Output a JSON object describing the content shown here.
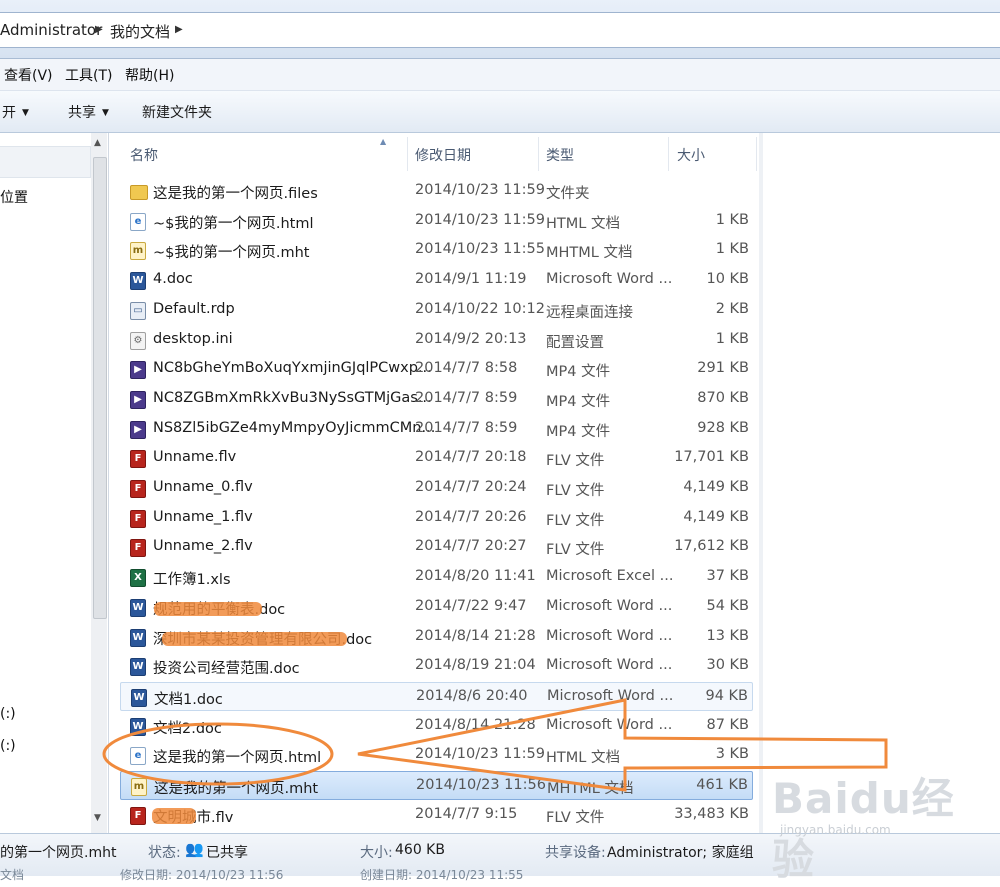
{
  "breadcrumb": {
    "items": [
      "Administrator",
      "我的文档"
    ]
  },
  "menu": {
    "items": [
      "查看(V)",
      "工具(T)",
      "帮助(H)"
    ]
  },
  "toolbar": {
    "open_label": "开",
    "share_label": "共享",
    "new_folder_label": "新建文件夹"
  },
  "nav": {
    "items": [
      "位置",
      "(:)",
      "(:)"
    ]
  },
  "columns": {
    "name": "名称",
    "date": "修改日期",
    "type": "类型",
    "size": "大小"
  },
  "files": [
    {
      "icon": "folder-icon",
      "name": "这是我的第一个网页.files",
      "date": "2014/10/23 11:59",
      "type": "文件夹",
      "size": ""
    },
    {
      "icon": "ie-html-icon",
      "name": "~$我的第一个网页.html",
      "date": "2014/10/23 11:59",
      "type": "HTML 文档",
      "size": "1 KB"
    },
    {
      "icon": "mht-icon",
      "name": "~$我的第一个网页.mht",
      "date": "2014/10/23 11:55",
      "type": "MHTML 文档",
      "size": "1 KB"
    },
    {
      "icon": "word-doc-icon",
      "name": "4.doc",
      "date": "2014/9/1 11:19",
      "type": "Microsoft Word ...",
      "size": "10 KB"
    },
    {
      "icon": "rdp-icon",
      "name": "Default.rdp",
      "date": "2014/10/22 10:12",
      "type": "远程桌面连接",
      "size": "2 KB"
    },
    {
      "icon": "ini-icon",
      "name": "desktop.ini",
      "date": "2014/9/2 20:13",
      "type": "配置设置",
      "size": "1 KB"
    },
    {
      "icon": "mp4-icon",
      "name": "NC8bGheYmBoXuqYxmjinGJqlPCwxp...",
      "date": "2014/7/7 8:58",
      "type": "MP4 文件",
      "size": "291 KB"
    },
    {
      "icon": "mp4-icon",
      "name": "NC8ZGBmXmRkXvBu3NySsGTMjGas...",
      "date": "2014/7/7 8:59",
      "type": "MP4 文件",
      "size": "870 KB"
    },
    {
      "icon": "mp4-icon",
      "name": "NS8Zl5ibGZe4myMmpyOyJicmmCMn...",
      "date": "2014/7/7 8:59",
      "type": "MP4 文件",
      "size": "928 KB"
    },
    {
      "icon": "flv-icon",
      "name": "Unname.flv",
      "date": "2014/7/7 20:18",
      "type": "FLV 文件",
      "size": "17,701 KB"
    },
    {
      "icon": "flv-icon",
      "name": "Unname_0.flv",
      "date": "2014/7/7 20:24",
      "type": "FLV 文件",
      "size": "4,149 KB"
    },
    {
      "icon": "flv-icon",
      "name": "Unname_1.flv",
      "date": "2014/7/7 20:26",
      "type": "FLV 文件",
      "size": "4,149 KB"
    },
    {
      "icon": "flv-icon",
      "name": "Unname_2.flv",
      "date": "2014/7/7 20:27",
      "type": "FLV 文件",
      "size": "17,612 KB"
    },
    {
      "icon": "excel-icon",
      "name": "工作簿1.xls",
      "date": "2014/8/20 11:41",
      "type": "Microsoft Excel ...",
      "size": "37 KB"
    },
    {
      "icon": "word-doc-icon",
      "name": "规范用的平衡表.doc",
      "date": "2014/7/22 9:47",
      "type": "Microsoft Word ...",
      "size": "54 KB"
    },
    {
      "icon": "word-doc-icon",
      "name": "深圳市某某投资管理有限公司.doc",
      "date": "2014/8/14 21:28",
      "type": "Microsoft Word ...",
      "size": "13 KB"
    },
    {
      "icon": "word-doc-icon",
      "name": "投资公司经营范围.doc",
      "date": "2014/8/19 21:04",
      "type": "Microsoft Word ...",
      "size": "30 KB"
    },
    {
      "icon": "word-doc-icon",
      "name": "文档1.doc",
      "date": "2014/8/6 20:40",
      "type": "Microsoft Word ...",
      "size": "94 KB"
    },
    {
      "icon": "word-doc-icon",
      "name": "文档2.doc",
      "date": "2014/8/14 21:28",
      "type": "Microsoft Word ...",
      "size": "87 KB"
    },
    {
      "icon": "ie-html-icon",
      "name": "这是我的第一个网页.html",
      "date": "2014/10/23 11:59",
      "type": "HTML 文档",
      "size": "3 KB"
    },
    {
      "icon": "mht-icon",
      "name": "这是我的第一个网页.mht",
      "date": "2014/10/23 11:56",
      "type": "MHTML 文档",
      "size": "461 KB"
    },
    {
      "icon": "flv-icon",
      "name": "文明城市.flv",
      "date": "2014/7/7 9:15",
      "type": "FLV 文件",
      "size": "33,483 KB"
    }
  ],
  "details": {
    "filename": "的第一个网页.mht",
    "status_label": "状态:",
    "status_value": "已共享",
    "size_label": "大小:",
    "size_value": "460 KB",
    "shared_label": "共享设备:",
    "shared_value": "Administrator; 家庭组",
    "modified_partial": "修改日期: 2014/10/23 11:56",
    "created_partial": "创建日期: 2014/10/23 11:55",
    "type_partial": "文档"
  },
  "watermark": {
    "text": "Baidu经验",
    "url": "jingyan.baidu.com"
  },
  "colors": {
    "annotation": "#f08a3c",
    "selection": "#c4dcf6"
  }
}
